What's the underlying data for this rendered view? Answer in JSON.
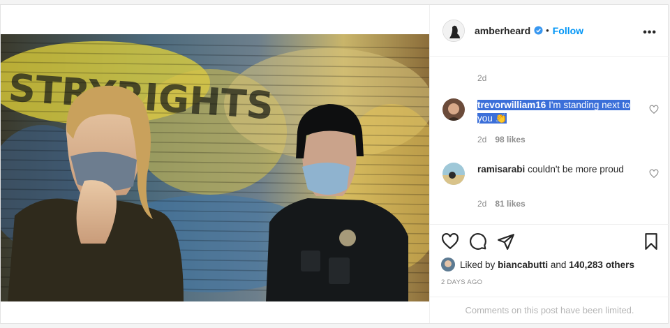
{
  "post": {
    "author": "amberheard",
    "follow_label": "Follow",
    "dot": "•",
    "more_label": "•••",
    "top_age": "2d",
    "comments": [
      {
        "user": "trevorwilliam16",
        "text": "I'm standing next to you",
        "emoji": "👏",
        "age": "2d",
        "likes": "98 likes"
      },
      {
        "user": "ramisarabi",
        "text": "couldn't be more proud",
        "age": "2d",
        "likes": "81 likes"
      }
    ],
    "liked_by": {
      "prefix": "Liked by",
      "user": "biancabutti",
      "and": "and",
      "count": "140,283 others"
    },
    "date": "2 DAYS AGO",
    "comments_limited": "Comments on this post have been limited.",
    "colors": {
      "follow": "#0095f6",
      "verified": "#3897f0",
      "highlight": "#3b6fd9"
    },
    "icons": [
      "verified-badge-icon",
      "more-options-icon",
      "heart-icon",
      "comment-icon",
      "share-icon",
      "bookmark-icon"
    ]
  }
}
